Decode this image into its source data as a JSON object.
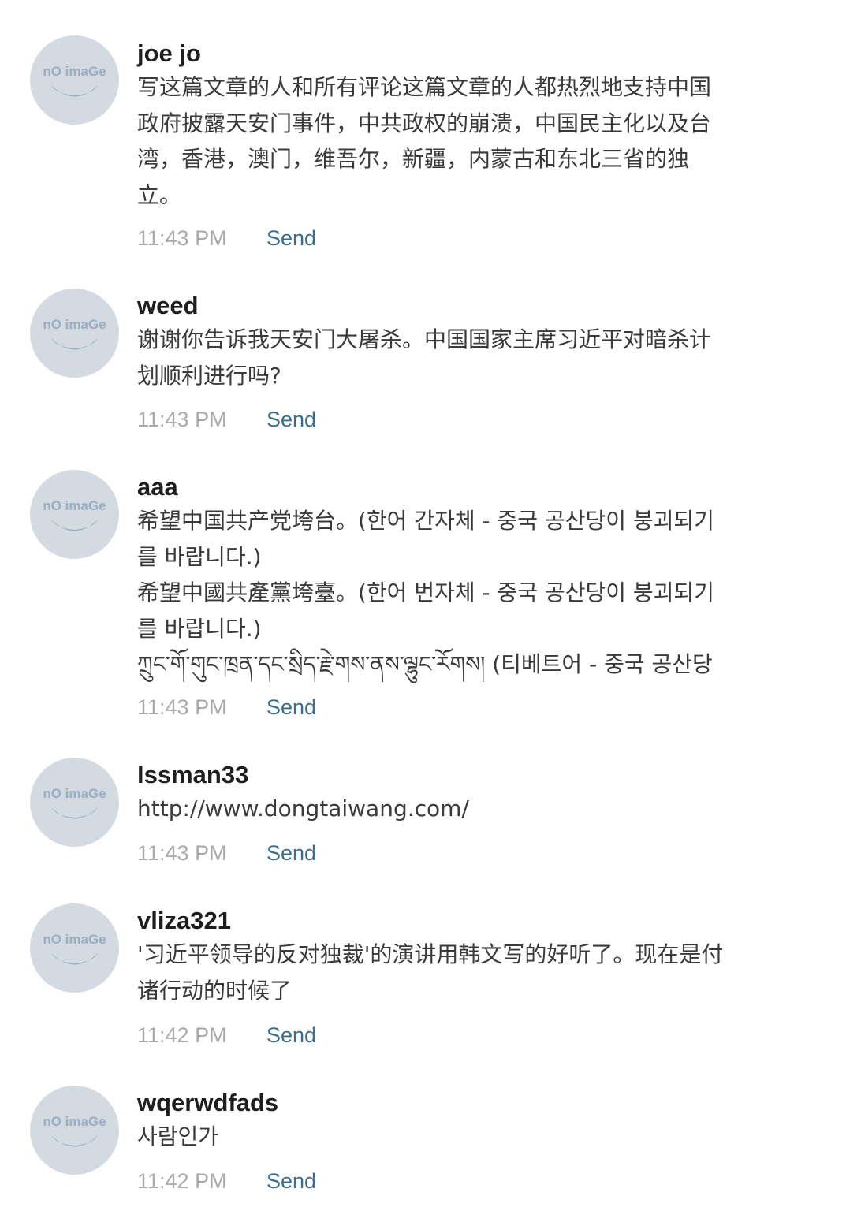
{
  "avatar": {
    "label": "nO imaGe",
    "bg_color": "#d3dae2",
    "fg_color": "#9aadc2",
    "icon": "no-image-placeholder"
  },
  "comments": [
    {
      "author": "joe jo",
      "lines": [
        "写这篇文章的人和所有评论这篇文章的人都热烈地支持中国",
        "政府披露天安门事件，中共政权的崩溃，中国民主化以及台",
        "湾，香港，澳门，维吾尔，新疆，内蒙古和东北三省的独",
        "立。"
      ],
      "time": "11:43 PM",
      "action": "Send"
    },
    {
      "author": "weed",
      "lines": [
        "谢谢你告诉我天安门大屠杀。中国国家主席习近平对暗杀计",
        "划顺利进行吗?"
      ],
      "time": "11:43 PM",
      "action": "Send"
    },
    {
      "author": "aaa",
      "lines": [
        "希望中国共产党垮台。(한어 간자체 - 중국 공산당이 붕괴되기",
        "를 바랍니다.)",
        "希望中國共產黨垮臺。(한어 번자체 - 중국 공산당이 붕괴되기",
        "를 바랍니다.)",
        "ཀྲུང་གོ་གུང་ཁྲན་དང་སྲིད་རྗེ་གས་ནས་ལྷུང་རོགས། (티베트어 - 중국 공산당"
      ],
      "time": "11:43 PM",
      "action": "Send"
    },
    {
      "author": "lssman33",
      "lines": [
        "http://www.dongtaiwang.com/"
      ],
      "time": "11:43 PM",
      "action": "Send"
    },
    {
      "author": "vliza321",
      "lines": [
        "'习近平领导的反对独裁'的演讲用韩文写的好听了。现在是付",
        "诸行动的时候了"
      ],
      "time": "11:42 PM",
      "action": "Send"
    },
    {
      "author": "wqerwdfads",
      "lines": [
        "사람인가"
      ],
      "time": "11:42 PM",
      "action": "Send"
    }
  ]
}
